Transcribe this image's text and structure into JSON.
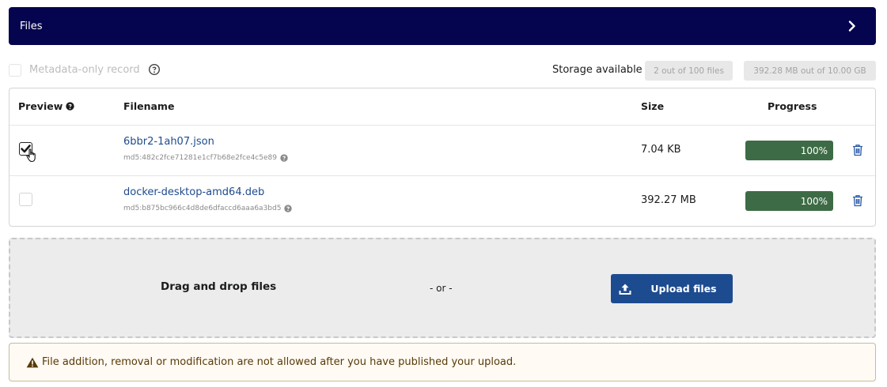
{
  "header": {
    "title": "Files"
  },
  "metadata": {
    "label": "Metadata-only record"
  },
  "storage": {
    "label": "Storage available",
    "files_badge": "2 out of 100 files",
    "size_badge": "392.28 MB out of 10.00 GB"
  },
  "table": {
    "columns": {
      "preview": "Preview",
      "filename": "Filename",
      "size": "Size",
      "progress": "Progress"
    },
    "rows": [
      {
        "filename": "6bbr2-1ah07.json",
        "md5": "md5:482c2fce71281e1cf7b68e2fce4c5e89",
        "size": "7.04 KB",
        "progress": "100%",
        "preview_checked": true
      },
      {
        "filename": "docker-desktop-amd64.deb",
        "md5": "md5:b875bc966c4d8de6dfaccd6aaa6a3bd5",
        "size": "392.27 MB",
        "progress": "100%",
        "preview_checked": false
      }
    ]
  },
  "dropzone": {
    "text": "Drag and drop files",
    "or": "- or -",
    "button": "Upload files"
  },
  "warning": {
    "text": "File addition, removal or modification are not allowed after you have published your upload."
  },
  "colors": {
    "header_bg": "#05054f",
    "progress_bg": "#3d6b45",
    "button_bg": "#1d4b8f"
  },
  "icons": {
    "chevron": "chevron-right-icon",
    "help": "help-circle-icon",
    "trash": "trash-icon",
    "upload": "upload-icon",
    "warning": "warning-triangle-icon"
  }
}
